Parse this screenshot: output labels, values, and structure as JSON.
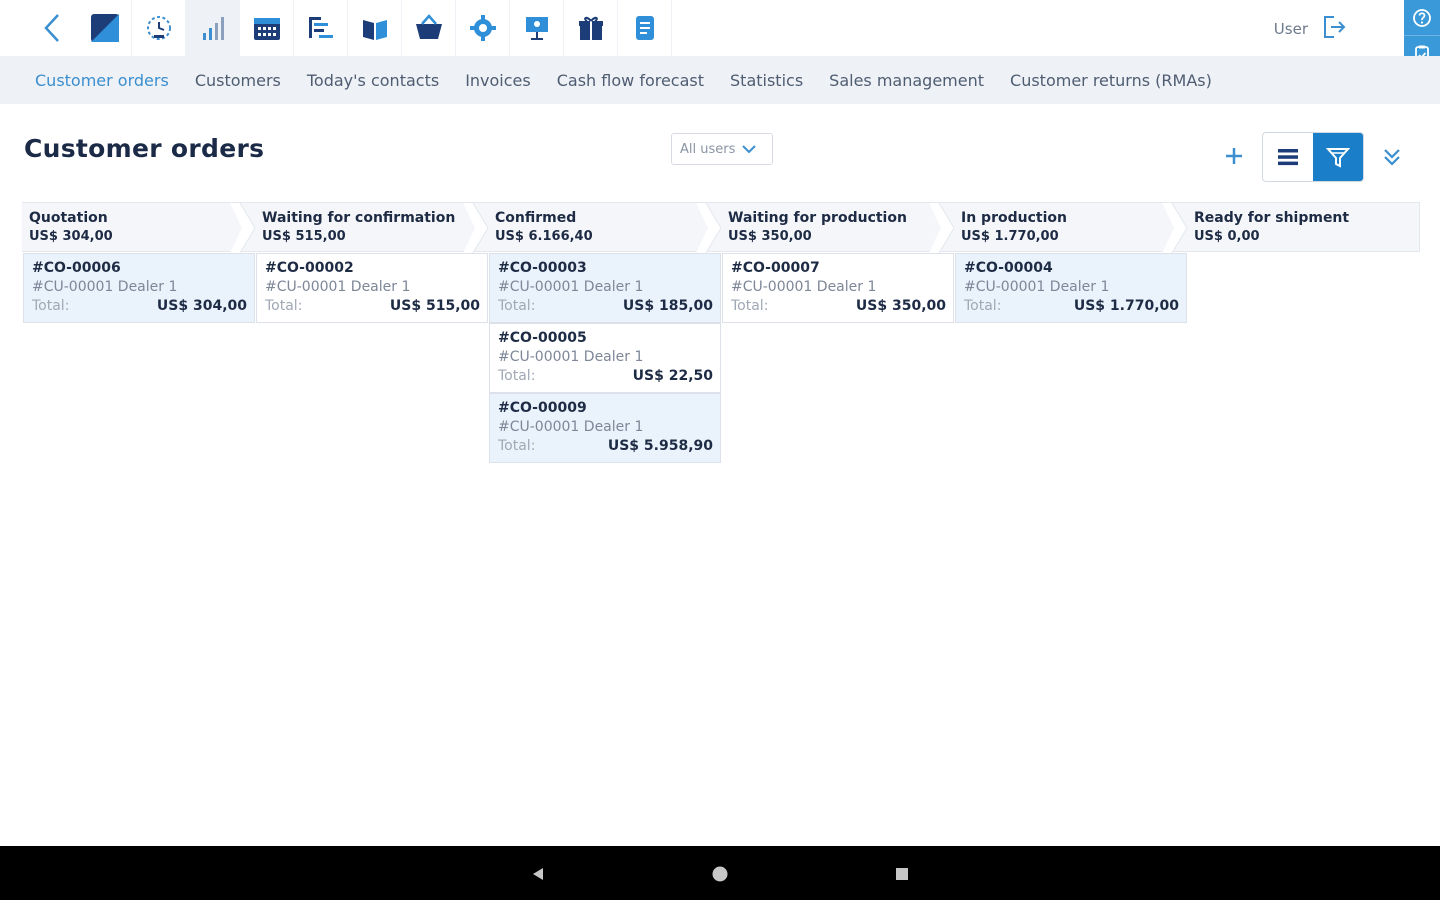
{
  "toolbar": {
    "back_icon": "chevron-left-icon",
    "icons": [
      {
        "name": "app-logo-icon",
        "active": false
      },
      {
        "name": "dashboard-clock-icon",
        "active": false
      },
      {
        "name": "bar-chart-icon",
        "active": true
      },
      {
        "name": "calendar-icon",
        "active": false
      },
      {
        "name": "list-tree-icon",
        "active": false
      },
      {
        "name": "book-icon",
        "active": false
      },
      {
        "name": "basket-icon",
        "active": false
      },
      {
        "name": "gear-icon",
        "active": false
      },
      {
        "name": "presentation-icon",
        "active": false
      },
      {
        "name": "gift-icon",
        "active": false
      },
      {
        "name": "document-icon",
        "active": false
      }
    ],
    "user_label": "User",
    "logout_icon": "logout-icon",
    "side_buttons": [
      "help-icon",
      "clipboard-icon"
    ]
  },
  "nav": {
    "tabs": [
      {
        "label": "Customer orders",
        "active": true
      },
      {
        "label": "Customers",
        "active": false
      },
      {
        "label": "Today's contacts",
        "active": false
      },
      {
        "label": "Invoices",
        "active": false
      },
      {
        "label": "Cash flow forecast",
        "active": false
      },
      {
        "label": "Statistics",
        "active": false
      },
      {
        "label": "Sales management",
        "active": false
      },
      {
        "label": "Customer returns (RMAs)",
        "active": false
      }
    ]
  },
  "header": {
    "title": "Customer orders",
    "user_filter": "All users"
  },
  "board": {
    "card_label_total": "Total:",
    "stages": [
      {
        "name": "Quotation",
        "total": "US$ 304,00",
        "cards": [
          {
            "code": "#CO-00006",
            "customer": "#CU-00001 Dealer 1",
            "total": "US$ 304,00",
            "highlight": true
          }
        ]
      },
      {
        "name": "Waiting for confirmation",
        "total": "US$ 515,00",
        "cards": [
          {
            "code": "#CO-00002",
            "customer": "#CU-00001 Dealer 1",
            "total": "US$ 515,00",
            "highlight": false
          }
        ]
      },
      {
        "name": "Confirmed",
        "total": "US$ 6.166,40",
        "cards": [
          {
            "code": "#CO-00003",
            "customer": "#CU-00001 Dealer 1",
            "total": "US$ 185,00",
            "highlight": true
          },
          {
            "code": "#CO-00005",
            "customer": "#CU-00001 Dealer 1",
            "total": "US$ 22,50",
            "highlight": false
          },
          {
            "code": "#CO-00009",
            "customer": "#CU-00001 Dealer 1",
            "total": "US$ 5.958,90",
            "highlight": true
          }
        ]
      },
      {
        "name": "Waiting for production",
        "total": "US$ 350,00",
        "cards": [
          {
            "code": "#CO-00007",
            "customer": "#CU-00001 Dealer 1",
            "total": "US$ 350,00",
            "highlight": false
          }
        ]
      },
      {
        "name": "In production",
        "total": "US$ 1.770,00",
        "cards": [
          {
            "code": "#CO-00004",
            "customer": "#CU-00001 Dealer 1",
            "total": "US$ 1.770,00",
            "highlight": true
          }
        ]
      },
      {
        "name": "Ready for shipment",
        "total": "US$ 0,00",
        "cards": []
      }
    ]
  },
  "android": {
    "buttons": [
      "back-triangle-icon",
      "home-circle-icon",
      "recents-square-icon"
    ]
  },
  "colors": {
    "accent": "#1a7ec8",
    "tab_active": "#3b8fd0",
    "card_highlight": "#eaf3fc",
    "navbar_bg": "#eef1f5"
  }
}
